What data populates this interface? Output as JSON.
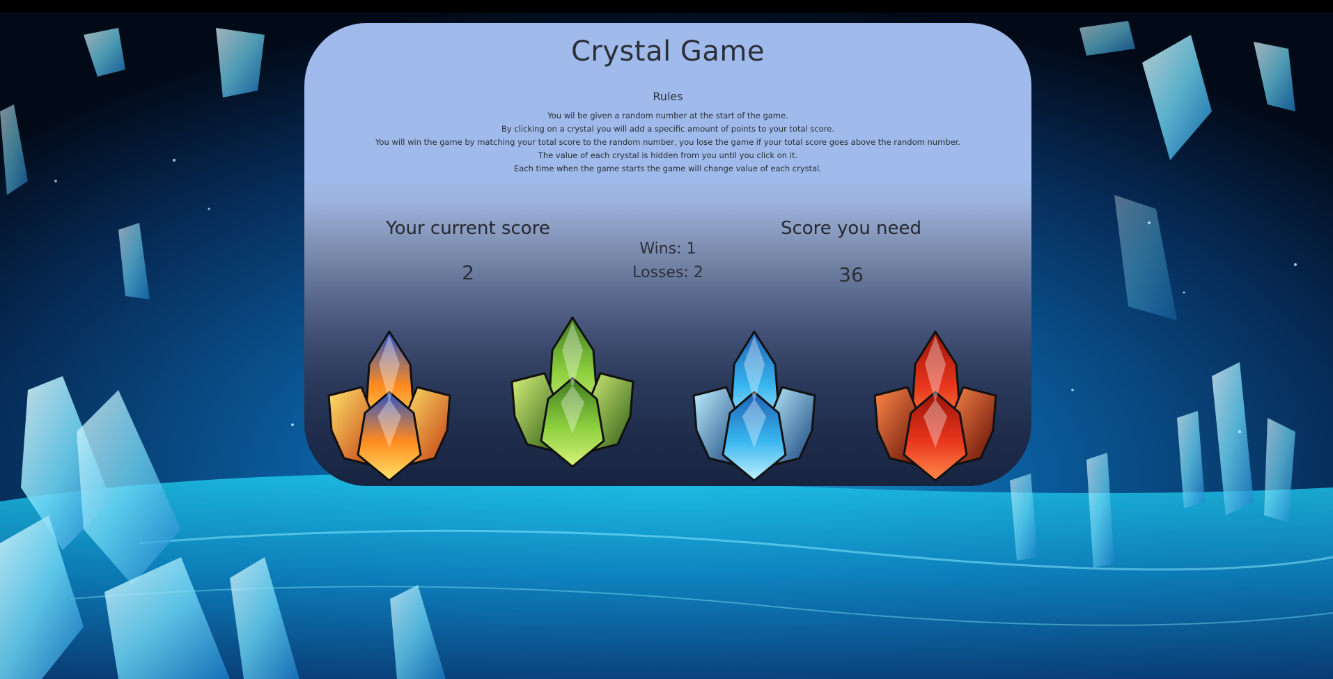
{
  "game": {
    "title": "Crystal Game",
    "rules_heading": "Rules",
    "rules": [
      "You wil be given a random number at the start of the game.",
      "By clicking on a crystal you will add a specific amount of points to your total score.",
      "You will win the game by matching your total score to the random number, you lose the game if your total score goes above the random number.",
      "The value of each crystal is hidden from you until you click on it.",
      "Each time when the game starts the game will change value of each crystal."
    ],
    "current_score_label": "Your current score",
    "current_score": "2",
    "target_label": "Score you need",
    "target_score": "36",
    "wins_text": "Wins: 1",
    "losses_text": "Losses: 2"
  },
  "crystals": [
    {
      "name": "fire-crystal",
      "colors": [
        "#2a54c8",
        "#ff8a1e",
        "#ffe46a",
        "#c23a10"
      ]
    },
    {
      "name": "green-crystal",
      "colors": [
        "#3e7a1e",
        "#8ccf3e",
        "#d6f27a",
        "#2c5a14"
      ]
    },
    {
      "name": "blue-crystal",
      "colors": [
        "#1f5fb4",
        "#38b6f0",
        "#bff0ff",
        "#123f7a"
      ]
    },
    {
      "name": "red-crystal",
      "colors": [
        "#9a1208",
        "#e8361c",
        "#ff8a4a",
        "#5c0804"
      ]
    }
  ],
  "colors": {
    "panel_top": "#a0bbeb",
    "panel_bottom": "#172441",
    "text": "#2b2f38"
  }
}
